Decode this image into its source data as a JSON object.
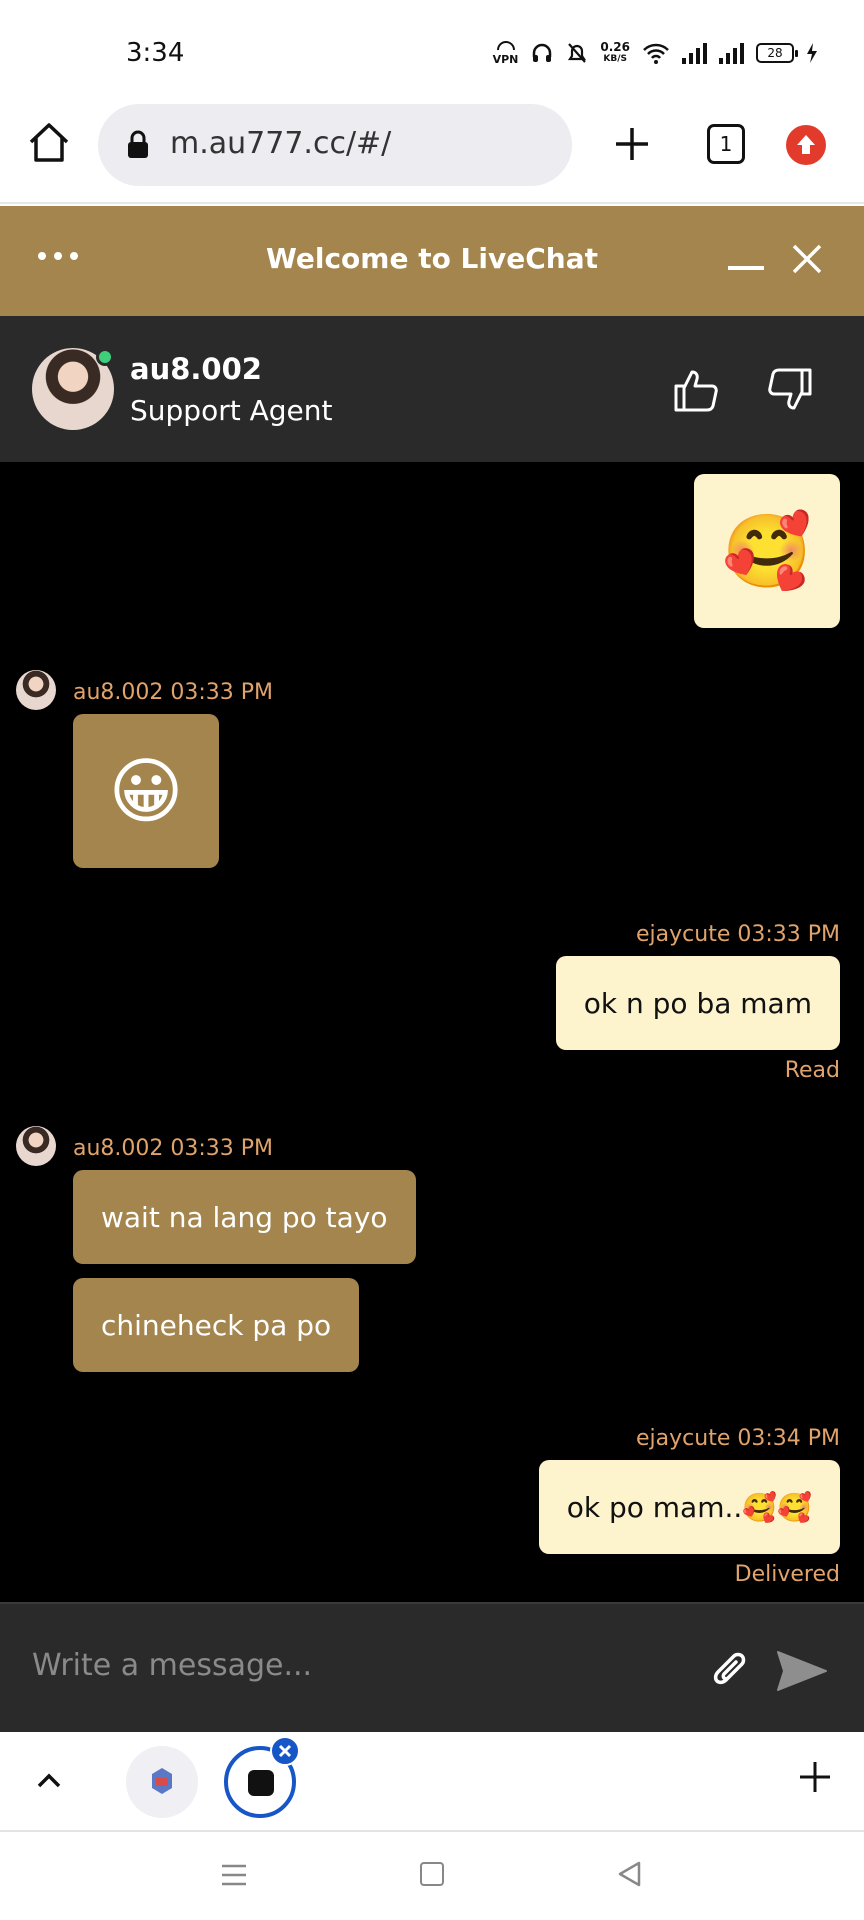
{
  "status_bar": {
    "time": "3:34",
    "vpn": "VPN",
    "speed_value": "0.26",
    "speed_unit": "KB/S",
    "battery": "28"
  },
  "browser": {
    "url": "m.au777.cc/#/",
    "tab_count": "1"
  },
  "chat": {
    "title": "Welcome to LiveChat",
    "agent_name": "au8.002",
    "agent_role": "Support Agent",
    "composer_placeholder": "Write a message..."
  },
  "messages": {
    "m1": {
      "emoji": "🥰"
    },
    "m2": {
      "meta": "au8.002 03:33 PM",
      "emoji": "😀"
    },
    "m3": {
      "meta": "ejaycute 03:33 PM",
      "text": "ok n po ba mam",
      "status": "Read"
    },
    "m4": {
      "meta": "au8.002 03:33 PM",
      "text1": "wait na lang po tayo",
      "text2": "chineheck pa po"
    },
    "m5": {
      "meta": "ejaycute 03:34 PM",
      "text": "ok po mam..🥰🥰",
      "status": "Delivered"
    }
  },
  "colors": {
    "gold": "#a3854d",
    "cream": "#fdf3cd",
    "meta": "#e0a36b",
    "online": "#3fcf7a",
    "tab_accent": "#1756c7"
  }
}
